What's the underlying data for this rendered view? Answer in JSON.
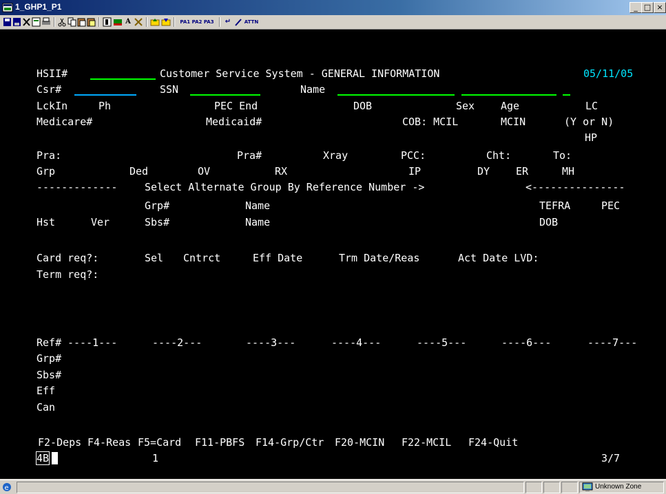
{
  "window": {
    "title": "1_GHP1_P1",
    "minimize": "_",
    "maximize": "□",
    "close": "×"
  },
  "toolbar": {
    "icons": [
      "save-icon",
      "save-as-icon",
      "delete-icon",
      "edit-icon",
      "print-icon",
      "cut-icon",
      "copy-icon",
      "paste-icon",
      "paste-special-icon",
      "format-icon",
      "marker-icon",
      "font-icon",
      "tools-icon",
      "send-icon",
      "receive-icon"
    ],
    "pa_keys": "PA1 PA2 PA3",
    "enter_glyph": "↵",
    "attn_label": "ATTN"
  },
  "screen": {
    "header": {
      "hsii_label": "HSII#",
      "title": "Customer Service System - GENERAL INFORMATION",
      "date": "05/11/05"
    },
    "row2": {
      "csr_label": "Csr#",
      "ssn_label": "SSN",
      "name_label": "Name"
    },
    "row3": {
      "lckin": "LckIn",
      "ph": "Ph",
      "pec_end": "PEC End",
      "dob": "DOB",
      "sex": "Sex",
      "age": "Age",
      "lc": "LC"
    },
    "row4": {
      "medicare": "Medicare#",
      "medicaid": "Medicaid#",
      "cob": "COB: MCIL",
      "mcin": "MCIN",
      "yn": "(Y or N)"
    },
    "row5": {
      "hp": "HP"
    },
    "row6": {
      "pra": "Pra:",
      "pra_num": "Pra#",
      "xray": "Xray",
      "pcc": "PCC:",
      "cht": "Cht:",
      "to": "To:"
    },
    "row7": {
      "grp": "Grp",
      "ded": "Ded",
      "ov": "OV",
      "rx": "RX",
      "ip": "IP",
      "dy": "DY",
      "er": "ER",
      "mh": "MH"
    },
    "separator": {
      "left": "-------------",
      "text": "Select Alternate Group By Reference Number ->",
      "right": "<---------------"
    },
    "row9": {
      "grp_num": "Grp#",
      "name": "Name",
      "tefra": "TEFRA",
      "pec": "PEC"
    },
    "row10": {
      "hst": "Hst",
      "ver": "Ver",
      "sbs_num": "Sbs#",
      "name": "Name",
      "dob": "DOB"
    },
    "row12": {
      "card_req": "Card req?:",
      "sel": "Sel",
      "cntrct": "Cntrct",
      "eff_date": "Eff Date",
      "trm": "Trm Date/Reas",
      "act": "Act Date LVD:"
    },
    "row13": {
      "term_req": "Term req?:"
    },
    "ref_row": {
      "label": "Ref#",
      "cols": [
        "----1---",
        "----2---",
        "----3---",
        "----4---",
        "----5---",
        "----6---",
        "----7---"
      ]
    },
    "ref_labels": [
      "Grp#",
      "Sbs#",
      "Eff",
      "Can"
    ],
    "fkeys": [
      "F2-Deps",
      "F4-Reas",
      "F5=Card",
      "F11-PBFS",
      "F14-Grp/Ctr",
      "F20-MCIN",
      "F22-MCIL",
      "F24-Quit"
    ],
    "bottom": {
      "input_value": "4B",
      "count": "1",
      "page": "3/7"
    }
  },
  "statusbar": {
    "zone": "Unknown Zone"
  }
}
